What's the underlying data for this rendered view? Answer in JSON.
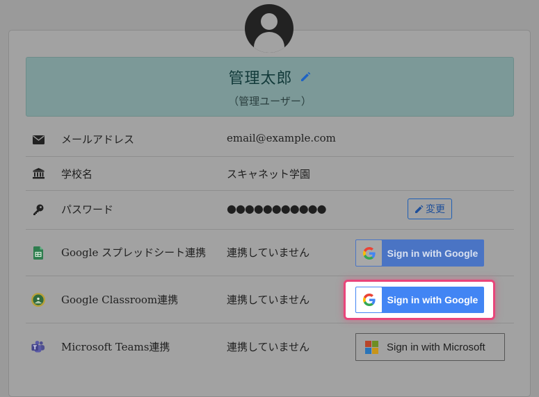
{
  "profile": {
    "name": "管理太郎",
    "role": "（管理ユーザー）"
  },
  "rows": {
    "email": {
      "label": "メールアドレス",
      "value": "email@example.com",
      "icon": "envelope-icon"
    },
    "school": {
      "label": "学校名",
      "value": "スキャネット学園",
      "icon": "school-building-icon"
    },
    "password": {
      "label": "パスワード",
      "value": "●●●●●●●●●●●",
      "icon": "key-icon",
      "change_label": "変更"
    },
    "sheets": {
      "label": "Google スプレッドシート連携",
      "value": "連携していません",
      "icon": "google-sheets-icon",
      "button": "Sign in with Google"
    },
    "classroom": {
      "label": "Google Classroom連携",
      "value": "連携していません",
      "icon": "google-classroom-icon",
      "button": "Sign in with Google"
    },
    "teams": {
      "label": "Microsoft Teams連携",
      "value": "連携していません",
      "icon": "microsoft-teams-icon",
      "button": "Sign in with Microsoft"
    }
  },
  "colors": {
    "google_blue": "#4285f4",
    "highlight": "#e8457a",
    "name_box": "#7c9998"
  }
}
